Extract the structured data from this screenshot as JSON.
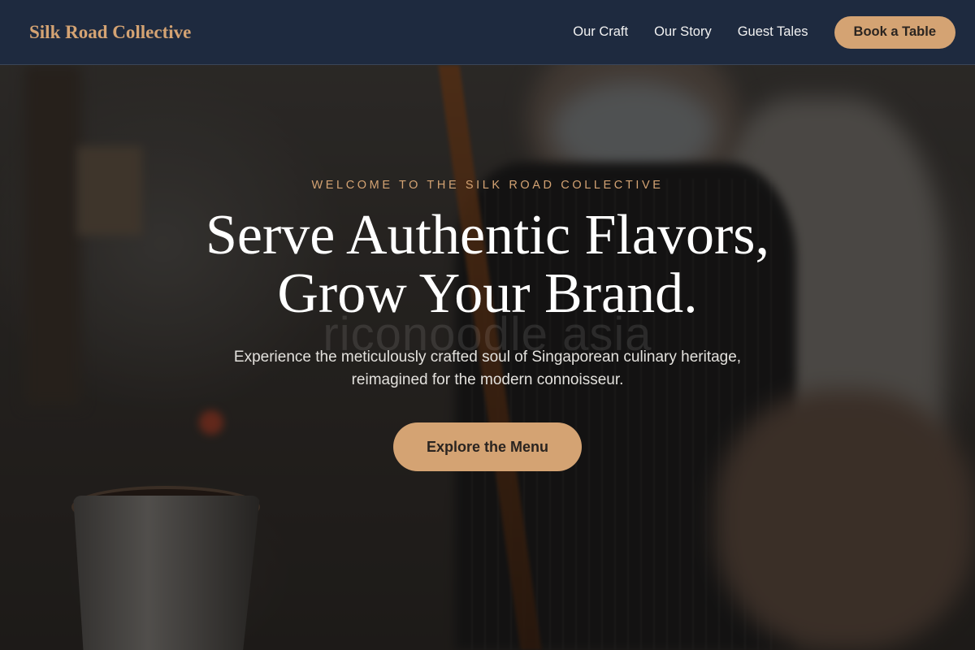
{
  "header": {
    "brand": "Silk Road Collective",
    "nav": [
      {
        "label": "Our Craft"
      },
      {
        "label": "Our Story"
      },
      {
        "label": "Guest Tales"
      }
    ],
    "cta_label": "Book a Table"
  },
  "hero": {
    "eyebrow": "WELCOME TO THE SILK ROAD COLLECTIVE",
    "headline_line1": "Serve Authentic Flavors,",
    "headline_line2": "Grow Your Brand.",
    "watermark": "riconoodle asia",
    "subtitle": "Experience the meticulously crafted soul of Singaporean culinary heritage, reimagined for the modern connoisseur.",
    "cta_label": "Explore the Menu"
  },
  "colors": {
    "accent": "#d4a373",
    "nav_background": "#1e2a3f",
    "text_light": "#ffffff"
  }
}
